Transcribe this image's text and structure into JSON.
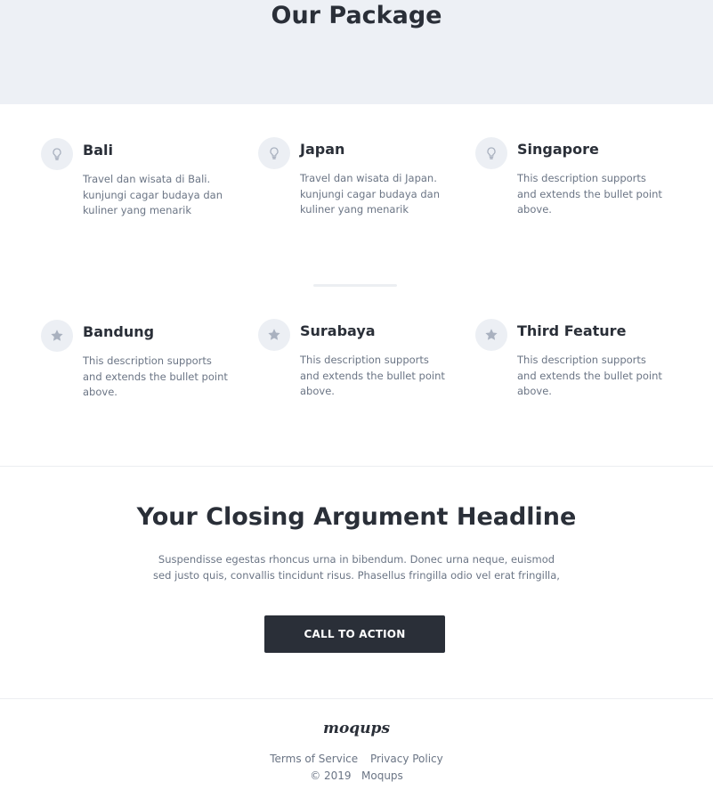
{
  "header": {
    "title": "Our Package"
  },
  "features": [
    {
      "title": "Bali",
      "description": "Travel dan wisata di Bali. kunjungi cagar budaya dan kuliner yang menarik",
      "icon": "lightbulb-icon"
    },
    {
      "title": "Japan",
      "description": "Travel dan wisata di Japan. kunjungi cagar budaya dan kuliner yang menarik",
      "icon": "lightbulb-icon"
    },
    {
      "title": "Singapore",
      "description": "This description supports and extends the bullet point above.",
      "icon": "lightbulb-icon"
    },
    {
      "title": "Bandung",
      "description": "This description supports and extends the bullet point above.",
      "icon": "star-icon"
    },
    {
      "title": "Surabaya",
      "description": "This description supports and extends the bullet point above.",
      "icon": "star-icon"
    },
    {
      "title": "Third Feature",
      "description": "This description supports and extends the bullet point above.",
      "icon": "star-icon"
    }
  ],
  "closing": {
    "headline": "Your Closing Argument Headline",
    "body": "Suspendisse egestas rhoncus urna in bibendum. Donec urna neque, euismod sed justo quis, convallis tincidunt risus. Phasellus fringilla odio vel erat fringilla,",
    "cta_label": "CALL TO ACTION"
  },
  "footer": {
    "logo": "moqups",
    "links": [
      "Terms of Service",
      "Privacy Policy"
    ],
    "copyright": "© 2019   Moqups"
  },
  "colors": {
    "dark": "#2a2f38",
    "muted": "#6b7585",
    "hero_bg": "#edf0f5",
    "icon": "#a9b1bf"
  }
}
